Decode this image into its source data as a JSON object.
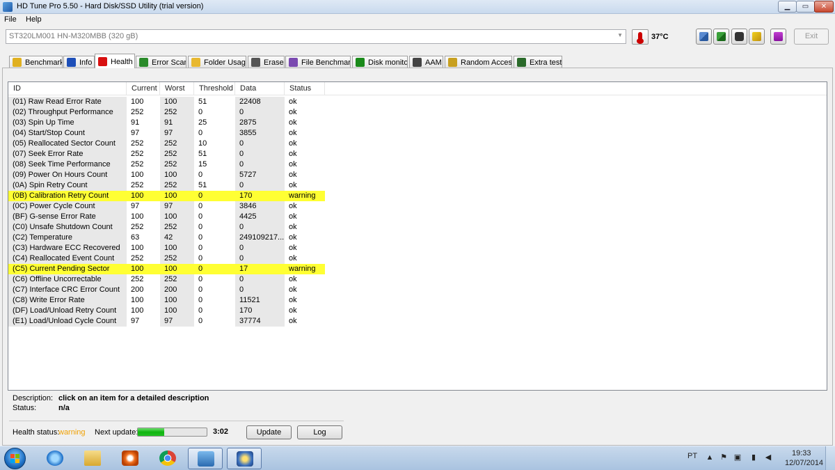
{
  "window": {
    "title": "HD Tune Pro 5.50 - Hard Disk/SSD Utility (trial version)",
    "min_glyph": "▁",
    "max_glyph": "▭",
    "close_glyph": "✕"
  },
  "menu": {
    "file": "File",
    "help": "Help"
  },
  "drive": {
    "selected": "ST320LM001 HN-M320MBB (320 gB)",
    "arrow": "▼"
  },
  "temperature": "37°C",
  "toolbar": {
    "exit_label": "Exit"
  },
  "tabs": [
    {
      "label": "Benchmark",
      "icon": "benchmark-icon",
      "color": "#e0b020"
    },
    {
      "label": "Info",
      "icon": "info-icon",
      "color": "#1e4fb8"
    },
    {
      "label": "Health",
      "icon": "health-cross-icon",
      "color": "#d81010"
    },
    {
      "label": "Error Scan",
      "icon": "magnifier-icon",
      "color": "#2a8a2a"
    },
    {
      "label": "Folder Usage",
      "icon": "folder-icon",
      "color": "#e8b830"
    },
    {
      "label": "Erase",
      "icon": "trash-icon",
      "color": "#555555"
    },
    {
      "label": "File Benchmark",
      "icon": "file-benchmark-icon",
      "color": "#7a4ab0"
    },
    {
      "label": "Disk monitor",
      "icon": "disk-monitor-icon",
      "color": "#1a8a1a"
    },
    {
      "label": "AAM",
      "icon": "speaker-icon",
      "color": "#444444"
    },
    {
      "label": "Random Access",
      "icon": "random-access-icon",
      "color": "#c8a020"
    },
    {
      "label": "Extra tests",
      "icon": "extra-tests-icon",
      "color": "#2a6a2a"
    }
  ],
  "table": {
    "headers": {
      "id": "ID",
      "current": "Current",
      "worst": "Worst",
      "threshold": "Threshold",
      "data": "Data",
      "status": "Status"
    },
    "rows": [
      {
        "id": "(01) Raw Read Error Rate",
        "current": "100",
        "worst": "100",
        "threshold": "51",
        "data": "22408",
        "status": "ok"
      },
      {
        "id": "(02) Throughput Performance",
        "current": "252",
        "worst": "252",
        "threshold": "0",
        "data": "0",
        "status": "ok"
      },
      {
        "id": "(03) Spin Up Time",
        "current": "91",
        "worst": "91",
        "threshold": "25",
        "data": "2875",
        "status": "ok"
      },
      {
        "id": "(04) Start/Stop Count",
        "current": "97",
        "worst": "97",
        "threshold": "0",
        "data": "3855",
        "status": "ok"
      },
      {
        "id": "(05) Reallocated Sector Count",
        "current": "252",
        "worst": "252",
        "threshold": "10",
        "data": "0",
        "status": "ok"
      },
      {
        "id": "(07) Seek Error Rate",
        "current": "252",
        "worst": "252",
        "threshold": "51",
        "data": "0",
        "status": "ok"
      },
      {
        "id": "(08) Seek Time Performance",
        "current": "252",
        "worst": "252",
        "threshold": "15",
        "data": "0",
        "status": "ok"
      },
      {
        "id": "(09) Power On Hours Count",
        "current": "100",
        "worst": "100",
        "threshold": "0",
        "data": "5727",
        "status": "ok"
      },
      {
        "id": "(0A) Spin Retry Count",
        "current": "252",
        "worst": "252",
        "threshold": "51",
        "data": "0",
        "status": "ok"
      },
      {
        "id": "(0B) Calibration Retry Count",
        "current": "100",
        "worst": "100",
        "threshold": "0",
        "data": "170",
        "status": "warning"
      },
      {
        "id": "(0C) Power Cycle Count",
        "current": "97",
        "worst": "97",
        "threshold": "0",
        "data": "3846",
        "status": "ok"
      },
      {
        "id": "(BF) G-sense Error Rate",
        "current": "100",
        "worst": "100",
        "threshold": "0",
        "data": "4425",
        "status": "ok"
      },
      {
        "id": "(C0) Unsafe Shutdown Count",
        "current": "252",
        "worst": "252",
        "threshold": "0",
        "data": "0",
        "status": "ok"
      },
      {
        "id": "(C2) Temperature",
        "current": "63",
        "worst": "42",
        "threshold": "0",
        "data": "249109217...",
        "status": "ok"
      },
      {
        "id": "(C3) Hardware ECC Recovered",
        "current": "100",
        "worst": "100",
        "threshold": "0",
        "data": "0",
        "status": "ok"
      },
      {
        "id": "(C4) Reallocated Event Count",
        "current": "252",
        "worst": "252",
        "threshold": "0",
        "data": "0",
        "status": "ok"
      },
      {
        "id": "(C5) Current Pending Sector",
        "current": "100",
        "worst": "100",
        "threshold": "0",
        "data": "17",
        "status": "warning"
      },
      {
        "id": "(C6) Offline Uncorrectable",
        "current": "252",
        "worst": "252",
        "threshold": "0",
        "data": "0",
        "status": "ok"
      },
      {
        "id": "(C7) Interface CRC Error Count",
        "current": "200",
        "worst": "200",
        "threshold": "0",
        "data": "0",
        "status": "ok"
      },
      {
        "id": "(C8) Write Error Rate",
        "current": "100",
        "worst": "100",
        "threshold": "0",
        "data": "11521",
        "status": "ok"
      },
      {
        "id": "(DF) Load/Unload Retry Count",
        "current": "100",
        "worst": "100",
        "threshold": "0",
        "data": "170",
        "status": "ok"
      },
      {
        "id": "(E1) Load/Unload Cycle Count",
        "current": "97",
        "worst": "97",
        "threshold": "0",
        "data": "37774",
        "status": "ok"
      }
    ]
  },
  "description": {
    "desc_label": "Description:",
    "desc_value": "click on an item for a detailed description",
    "status_label": "Status:",
    "status_value": "n/a"
  },
  "health": {
    "status_label": "Health status:",
    "status_value": "warning",
    "status_color": "#f0a000",
    "next_update_label": "Next update:",
    "next_update_progress": 0.38,
    "countdown": "3:02",
    "update_button": "Update",
    "log_button": "Log"
  },
  "taskbar": {
    "language": "PT",
    "time": "19:33",
    "date": "12/07/2014",
    "apps": [
      {
        "icon": "internet-explorer-icon"
      },
      {
        "icon": "file-explorer-icon"
      },
      {
        "icon": "media-player-icon"
      },
      {
        "icon": "chrome-icon"
      },
      {
        "icon": "network-app-icon"
      },
      {
        "icon": "hdtune-app-icon"
      }
    ]
  }
}
